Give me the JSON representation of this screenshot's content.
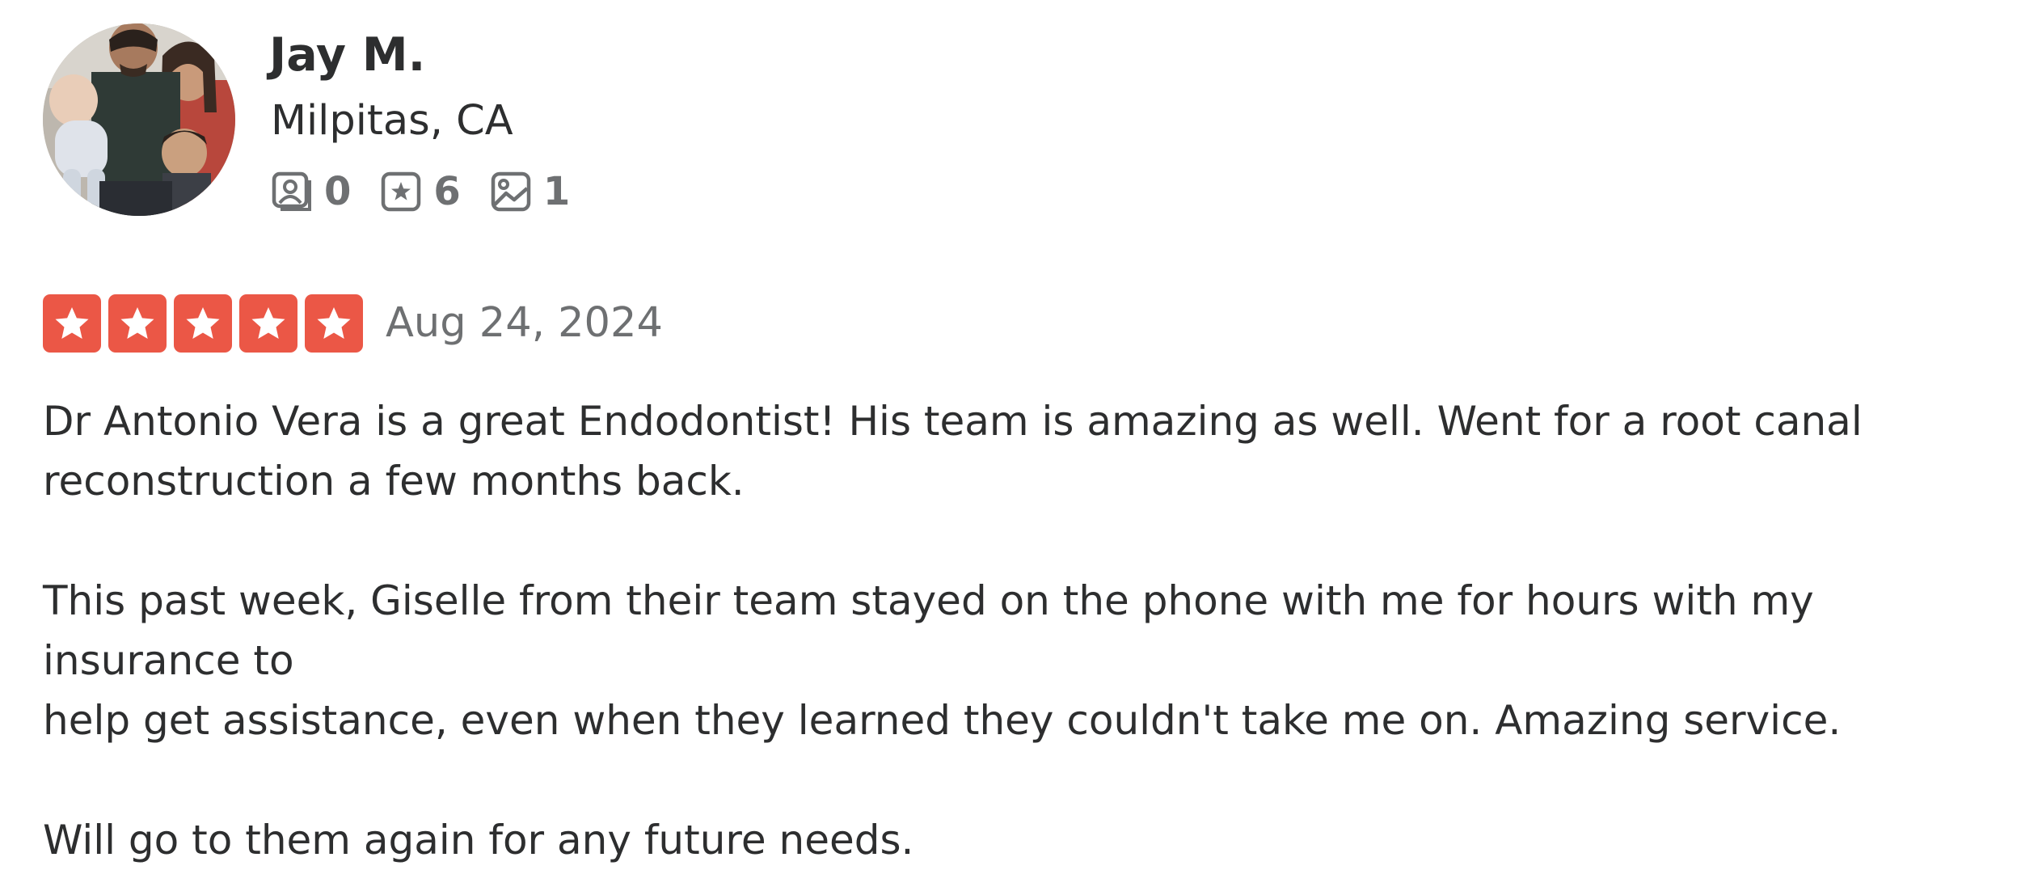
{
  "user": {
    "name": "Jay M.",
    "location": "Milpitas, CA",
    "avatar_icon": "user-photo-avatar",
    "stats": [
      {
        "icon": "friends-icon",
        "count": "0"
      },
      {
        "icon": "reviews-icon",
        "count": "6"
      },
      {
        "icon": "photos-icon",
        "count": "1"
      }
    ]
  },
  "review": {
    "rating": 5,
    "rating_max": 5,
    "date": "Aug 24, 2024",
    "paragraphs": [
      "Dr Antonio Vera is a great Endodontist! His team is amazing as well. Went for a root canal\nreconstruction a few months back.",
      "This past week, Giselle from their team stayed on the phone with me for hours with my insurance to\nhelp get assistance, even when they learned they couldn't take me on. Amazing service.",
      "Will go to them again for any future needs."
    ]
  },
  "colors": {
    "star_red": "#eb5746",
    "text_dark": "#2d2e2f",
    "text_muted": "#6e7072"
  }
}
